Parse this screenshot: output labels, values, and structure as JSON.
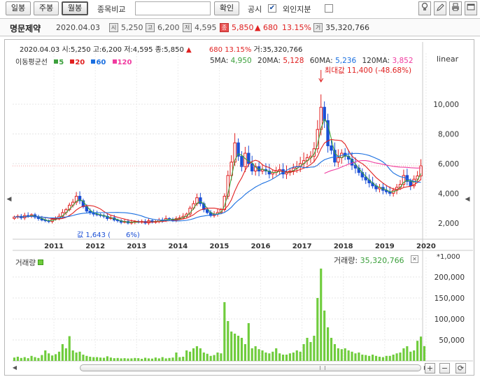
{
  "toolbar": {
    "tab_daily": "일봉",
    "tab_weekly": "주봉",
    "tab_monthly": "월봉",
    "compare_label": "종목비교",
    "compare_value": "",
    "confirm_label": "확인",
    "disclosure_label": "공시",
    "disclosure_check": "✔",
    "foreign_label": "외인지분"
  },
  "info": {
    "name": "명문제약",
    "date": "2020.04.03",
    "open_icon": "시",
    "open": "5,250",
    "high_icon": "고",
    "high": "6,200",
    "low_icon": "저",
    "low": "4,595",
    "close_icon": "종",
    "close": "5,850",
    "change": "▲ 680",
    "change_pct": "13.15%",
    "vol_icon": "거",
    "volume": "35,320,766"
  },
  "chart_header": {
    "date": "2020.04.03",
    "open_text": "시:5,250",
    "high_text": "고:6,200",
    "low_text": "저:4,595",
    "close_text": "종:5,850",
    "arrow": "▲",
    "change": "680",
    "pct": "13.15%",
    "vol_text": "거:35,320,766",
    "ma_label": "이동평균선",
    "ma_periods": [
      "5",
      "20",
      "60",
      "120"
    ],
    "ma5_label": "5MA:",
    "ma5_value": "4,950",
    "ma20_label": "20MA:",
    "ma20_value": "5,128",
    "ma60_label": "60MA:",
    "ma60_value": "5,236",
    "ma120_label": "120MA:",
    "ma120_value": "3,852",
    "scale_label": "linear",
    "max_annot": "최대값 11,400 (-48.68%)",
    "min_annot": "값 1,643 (",
    "min_annot2": "6%)",
    "vol_label": "거래량",
    "vol_info_label": "거래량:",
    "vol_info_value": "35,320,766",
    "vol_multiplier": "*1,000",
    "close_x": "✕"
  },
  "colors": {
    "up": "#e02020",
    "down": "#1a4fd6",
    "ma5": "#3ca03c",
    "ma20": "#e02020",
    "ma60": "#1a6fe0",
    "ma120": "#f03ca0",
    "volume": "#6fcc3c"
  },
  "chart_data": {
    "type": "candlestick",
    "title": "명문제약",
    "period": "monthly",
    "ylim": [
      1000,
      12500
    ],
    "y_ticks": [
      2000,
      4000,
      6000,
      8000,
      10000
    ],
    "y_tick_labels": [
      "2,000",
      "4,000",
      "6,000",
      "8,000",
      "10,000"
    ],
    "x_labels": [
      "2011",
      "2012",
      "2013",
      "2014",
      "2015",
      "2016",
      "2017",
      "2018",
      "2019",
      "2020"
    ],
    "x_label_months": [
      12,
      24,
      36,
      48,
      60,
      72,
      84,
      96,
      108,
      120
    ],
    "close": [
      2400,
      2450,
      2350,
      2500,
      2450,
      2550,
      2400,
      2300,
      2200,
      2150,
      2100,
      2250,
      2300,
      2450,
      2700,
      2900,
      3200,
      3400,
      3800,
      3500,
      3100,
      2800,
      2700,
      2600,
      2550,
      2500,
      2450,
      2300,
      2350,
      2200,
      2150,
      2050,
      2100,
      2000,
      2050,
      2100,
      2050,
      2100,
      2000,
      2150,
      2050,
      2100,
      2200,
      2150,
      2300,
      2250,
      2200,
      2300,
      2350,
      2450,
      2600,
      3000,
      3300,
      3700,
      3300,
      2900,
      2700,
      2500,
      2600,
      2700,
      2900,
      3800,
      5200,
      6100,
      7400,
      6500,
      5800,
      6700,
      6000,
      5500,
      5800,
      5500,
      5600,
      5500,
      5300,
      5400,
      5500,
      5600,
      5300,
      5400,
      5500,
      5700,
      5800,
      6000,
      6200,
      6400,
      6500,
      7000,
      8300,
      9800,
      8900,
      7200,
      6900,
      6100,
      6400,
      6700,
      6500,
      6300,
      5900,
      5700,
      5400,
      5100,
      4900,
      4700,
      4500,
      4300,
      4400,
      4200,
      4100,
      4000,
      4200,
      4400,
      4600,
      5200,
      4800,
      4500,
      4950,
      5170,
      5850
    ],
    "volume_ylim": [
      0,
      230000
    ],
    "volume_ticks": [
      50000,
      100000,
      150000,
      200000
    ],
    "volume_tick_labels": [
      "50,000",
      "100,000",
      "150,000",
      "200,000"
    ],
    "volume": [
      8000,
      10000,
      7000,
      9000,
      6500,
      12000,
      9000,
      7000,
      14000,
      25000,
      18000,
      13000,
      16000,
      22000,
      40000,
      30000,
      59000,
      25000,
      20000,
      22000,
      15000,
      12000,
      10000,
      9000,
      9000,
      8000,
      7500,
      11000,
      8000,
      6500,
      7000,
      6000,
      6500,
      5800,
      6000,
      7000,
      6500,
      5000,
      7500,
      6000,
      5500,
      8000,
      6000,
      9000,
      6000,
      7000,
      8000,
      20000,
      9000,
      10000,
      25000,
      22000,
      30000,
      35000,
      30000,
      20000,
      17000,
      12000,
      14000,
      20000,
      18000,
      140000,
      95000,
      70000,
      65000,
      60000,
      55000,
      40000,
      90000,
      30000,
      35000,
      28000,
      25000,
      20000,
      18000,
      22000,
      30000,
      18000,
      15000,
      15000,
      18000,
      20000,
      25000,
      22000,
      40000,
      55000,
      45000,
      60000,
      150000,
      220000,
      120000,
      80000,
      55000,
      40000,
      30000,
      28000,
      30000,
      25000,
      22000,
      18000,
      20000,
      15000,
      14000,
      12000,
      15000,
      12000,
      10000,
      9000,
      12000,
      12000,
      15000,
      18000,
      20000,
      30000,
      35000,
      22000,
      25000,
      48000,
      58000,
      35320
    ]
  }
}
